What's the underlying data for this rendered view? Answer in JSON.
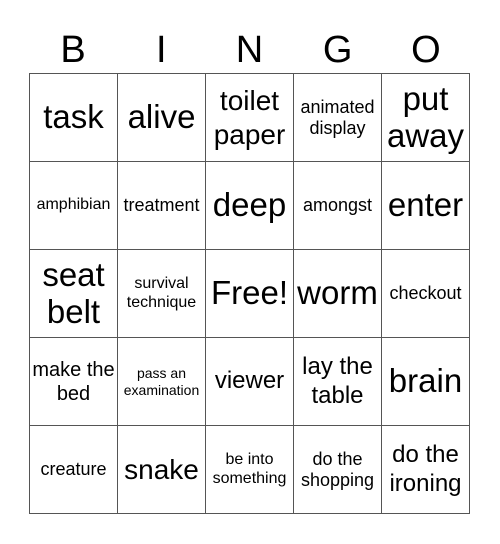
{
  "header": [
    "B",
    "I",
    "N",
    "G",
    "O"
  ],
  "cells": [
    {
      "text": "task",
      "size": "s-xl"
    },
    {
      "text": "alive",
      "size": "s-xl"
    },
    {
      "text": "toilet paper",
      "size": "s-l"
    },
    {
      "text": "animated display",
      "size": "s-s"
    },
    {
      "text": "put away",
      "size": "s-xl"
    },
    {
      "text": "amphibian",
      "size": "s-xs"
    },
    {
      "text": "treatment",
      "size": "s-s"
    },
    {
      "text": "deep",
      "size": "s-xl"
    },
    {
      "text": "amongst",
      "size": "s-s"
    },
    {
      "text": "enter",
      "size": "s-xl"
    },
    {
      "text": "seat belt",
      "size": "s-xl"
    },
    {
      "text": "survival technique",
      "size": "s-xs"
    },
    {
      "text": "Free!",
      "size": "s-xl"
    },
    {
      "text": "worm",
      "size": "s-xl"
    },
    {
      "text": "checkout",
      "size": "s-s"
    },
    {
      "text": "make the bed",
      "size": "s-m"
    },
    {
      "text": "pass an examination",
      "size": "s-xxs"
    },
    {
      "text": "viewer",
      "size": "s-ml"
    },
    {
      "text": "lay the table",
      "size": "s-ml"
    },
    {
      "text": "brain",
      "size": "s-xl"
    },
    {
      "text": "creature",
      "size": "s-s"
    },
    {
      "text": "snake",
      "size": "s-l"
    },
    {
      "text": "be into something",
      "size": "s-xs"
    },
    {
      "text": "do the shopping",
      "size": "s-s"
    },
    {
      "text": "do the ironing",
      "size": "s-ml"
    }
  ]
}
